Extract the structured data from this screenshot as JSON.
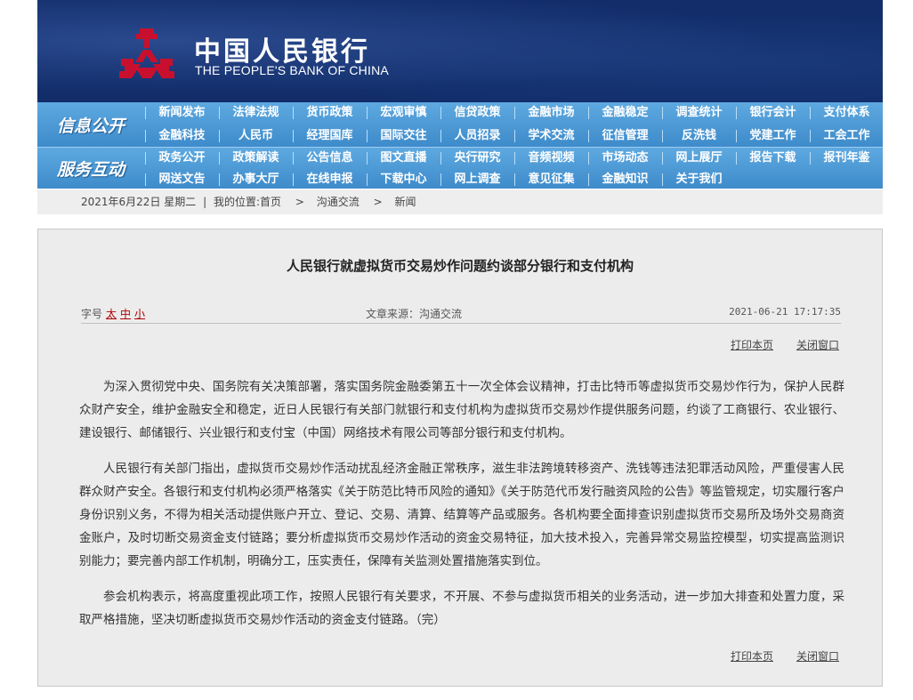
{
  "header": {
    "logo_cn": "中国人民银行",
    "logo_en": "THE PEOPLE'S BANK OF CHINA"
  },
  "nav": {
    "group1": {
      "label": "信息公开",
      "row1": [
        "新闻发布",
        "法律法规",
        "货币政策",
        "宏观审慎",
        "信贷政策",
        "金融市场",
        "金融稳定",
        "调查统计",
        "银行会计",
        "支付体系"
      ],
      "row2": [
        "金融科技",
        "人民币",
        "经理国库",
        "国际交往",
        "人员招录",
        "学术交流",
        "征信管理",
        "反洗钱",
        "党建工作",
        "工会工作"
      ]
    },
    "group2": {
      "label": "服务互动",
      "row1": [
        "政务公开",
        "政策解读",
        "公告信息",
        "图文直播",
        "央行研究",
        "音频视频",
        "市场动态",
        "网上展厅",
        "报告下载",
        "报刊年鉴"
      ],
      "row2": [
        "网送文告",
        "办事大厅",
        "在线申报",
        "下载中心",
        "网上调查",
        "意见征集",
        "金融知识",
        "关于我们"
      ]
    }
  },
  "breadcrumb": {
    "date": "2021年6月22日 星期二",
    "sep": "|",
    "location_label": "我的位置:",
    "home": "首页",
    "arrow": ">",
    "level1": "沟通交流",
    "level2": "新闻"
  },
  "article": {
    "title": "人民银行就虚拟货币交易炒作问题约谈部分银行和支付机构",
    "font_size_label": "字号",
    "font_large": "太",
    "font_medium": "中",
    "font_small": "小",
    "source": "文章来源：沟通交流",
    "date": "2021-06-21 17:17:35",
    "print": "打印本页",
    "close": "关闭窗口",
    "paragraphs": [
      "为深入贯彻党中央、国务院有关决策部署，落实国务院金融委第五十一次全体会议精神，打击比特币等虚拟货币交易炒作行为，保护人民群众财产安全，维护金融安全和稳定，近日人民银行有关部门就银行和支付机构为虚拟货币交易炒作提供服务问题，约谈了工商银行、农业银行、建设银行、邮储银行、兴业银行和支付宝（中国）网络技术有限公司等部分银行和支付机构。",
      "人民银行有关部门指出，虚拟货币交易炒作活动扰乱经济金融正常秩序，滋生非法跨境转移资产、洗钱等违法犯罪活动风险，严重侵害人民群众财产安全。各银行和支付机构必须严格落实《关于防范比特币风险的通知》《关于防范代币发行融资风险的公告》等监管规定，切实履行客户身份识别义务，不得为相关活动提供账户开立、登记、交易、清算、结算等产品或服务。各机构要全面排查识别虚拟货币交易所及场外交易商资金账户，及时切断交易资金支付链路；要分析虚拟货币交易炒作活动的资金交易特征，加大技术投入，完善异常交易监控模型，切实提高监测识别能力；要完善内部工作机制，明确分工，压实责任，保障有关监测处置措施落实到位。",
      "参会机构表示，将高度重视此项工作，按照人民银行有关要求，不开展、不参与虚拟货币相关的业务活动，进一步加大排查和处置力度，采取严格措施，坚决切断虚拟货币交易炒作活动的资金支付链路。（完）"
    ]
  }
}
